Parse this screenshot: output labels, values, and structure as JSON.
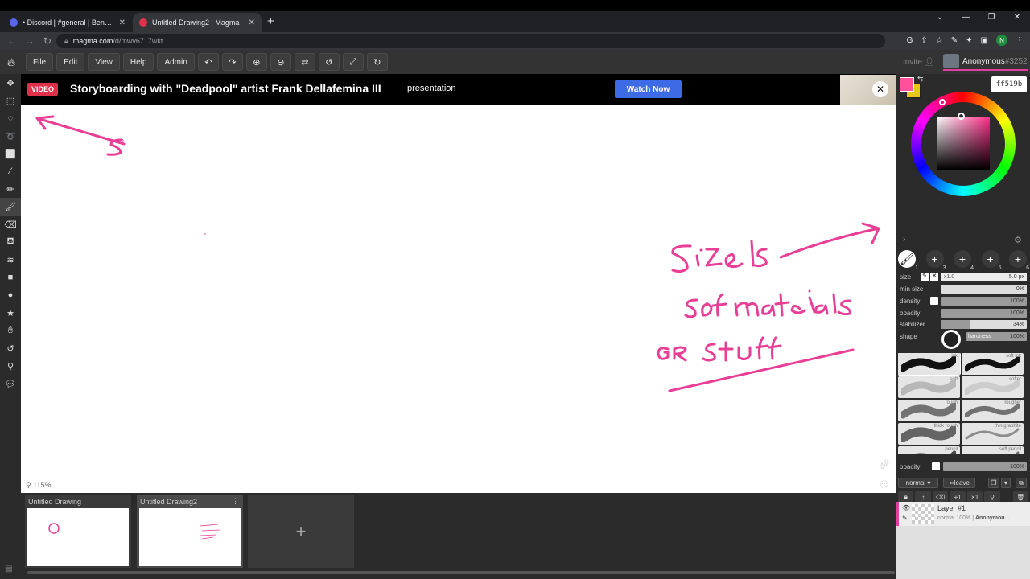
{
  "browser": {
    "tabs": [
      {
        "title": "• Discord | #general | Bendy and"
      },
      {
        "title": "Untitled Drawing2 | Magma"
      }
    ],
    "url_host": "magma.com",
    "url_path": "/d/mwv6717wkt",
    "profile_initial": "N"
  },
  "menu": {
    "file": "File",
    "edit": "Edit",
    "view": "View",
    "help": "Help",
    "admin": "Admin"
  },
  "user": {
    "invite": "Invite",
    "name": "Anonymous",
    "tag": "#3252"
  },
  "banner": {
    "badge": "VIDEO",
    "title": "Storyboarding with \"Deadpool\" artist Frank Dellafemina III",
    "subtitle": "presentation",
    "cta": "Watch Now"
  },
  "canvas": {
    "zoom": "115%",
    "stroke_color": "#e83e96"
  },
  "drawings": [
    {
      "title": "Untitled Drawing"
    },
    {
      "title": "Untitled Drawing2"
    }
  ],
  "color": {
    "primary": "#ff519b",
    "secondary": "#e8c61a",
    "hex": "ff519b"
  },
  "brush_slots": [
    "1",
    "3",
    "4",
    "5",
    "6"
  ],
  "props": {
    "size_label": "size",
    "size_mult": "x1.0",
    "size_value": "5.0 px",
    "minsize_label": "min size",
    "minsize_value": "0%",
    "density_label": "density",
    "density_value": "100%",
    "opacity_label": "opacity",
    "opacity_value": "100%",
    "stabilizer_label": "stabilizer",
    "stabilizer_value": "34%",
    "shape_label": "shape",
    "hardness_label": "hardness",
    "hardness_value": "100%"
  },
  "brushes": [
    "ink",
    "soft ink",
    "soft",
    "softer",
    "rough",
    "rougher",
    "thick rough",
    "thin graphite",
    "pencil",
    "soft pencil"
  ],
  "layer_panel": {
    "opacity_label": "opacity",
    "opacity_value": "100%",
    "blend": "normal",
    "leave": "leave",
    "add": "+1",
    "remove": "×1"
  },
  "layer": {
    "name": "Layer #1",
    "mode": "normal 100%",
    "owner": "Anonymou..."
  }
}
